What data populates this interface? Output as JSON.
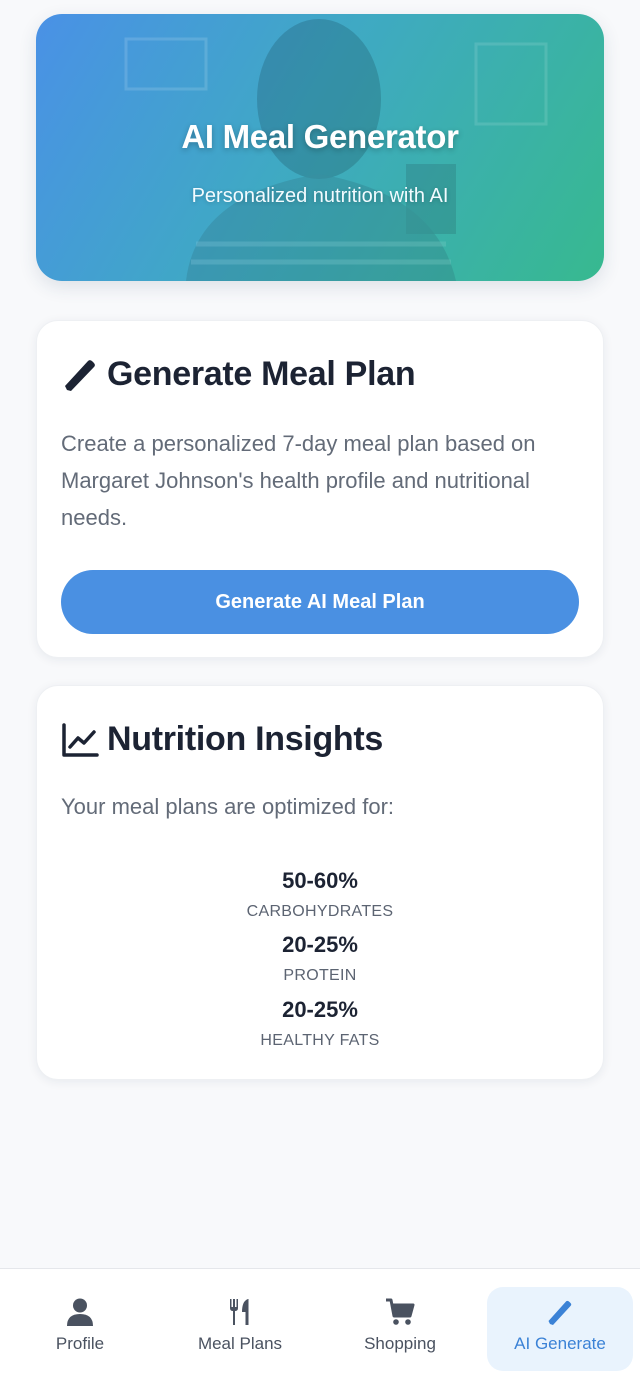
{
  "hero": {
    "title": "AI Meal Generator",
    "subtitle": "Personalized nutrition with AI"
  },
  "generate_card": {
    "icon": "pencil-icon",
    "title": "Generate Meal Plan",
    "description": "Create a personalized 7-day meal plan based on Margaret Johnson's health profile and nutritional needs.",
    "button_label": "Generate AI Meal Plan"
  },
  "insights_card": {
    "icon": "line-chart-icon",
    "title": "Nutrition Insights",
    "intro": "Your meal plans are optimized for:",
    "stats": [
      {
        "value": "50-60%",
        "label": "CARBOHYDRATES"
      },
      {
        "value": "20-25%",
        "label": "PROTEIN"
      },
      {
        "value": "20-25%",
        "label": "HEALTHY FATS"
      }
    ]
  },
  "bottom_nav": {
    "items": [
      {
        "label": "Profile",
        "icon": "user-icon"
      },
      {
        "label": "Meal Plans",
        "icon": "utensils-icon"
      },
      {
        "label": "Shopping",
        "icon": "cart-icon"
      },
      {
        "label": "AI Generate",
        "icon": "pencil-icon"
      }
    ],
    "active": "AI Generate"
  },
  "colors": {
    "accent": "#4a90e2",
    "hero_gradient_start": "#4a91e6",
    "hero_gradient_end": "#37b98f",
    "text_dark": "#1c2333",
    "text_muted": "#636b78"
  }
}
